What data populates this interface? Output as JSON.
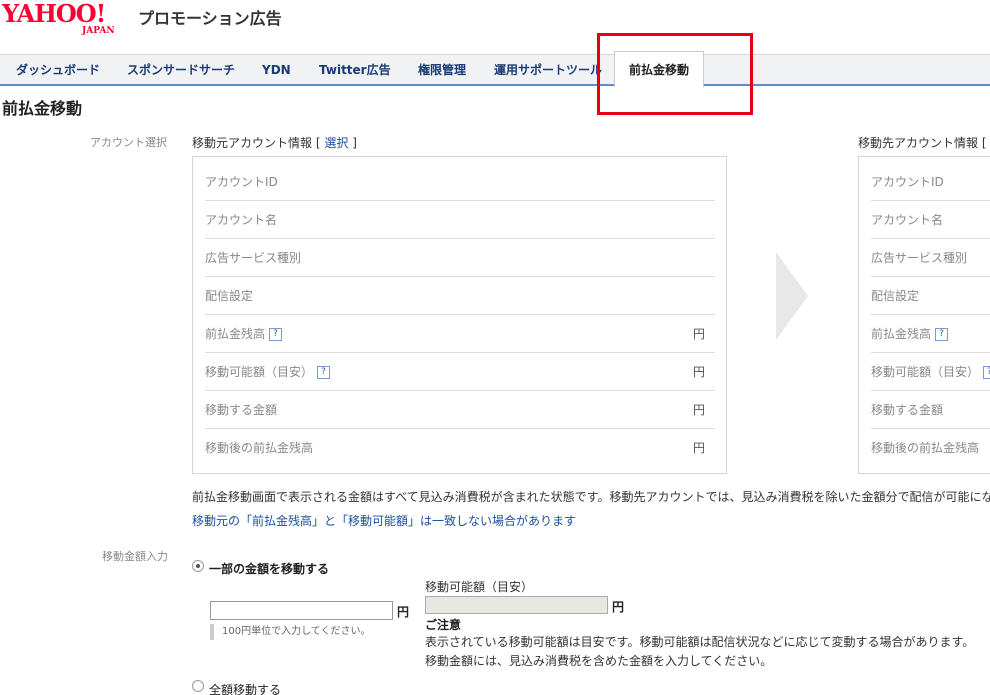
{
  "header": {
    "logo_text": "YAHOO!",
    "logo_sub": "JAPAN",
    "product_name": "プロモーション広告"
  },
  "nav": {
    "tabs": [
      {
        "label": "ダッシュボード"
      },
      {
        "label": "スポンサードサーチ"
      },
      {
        "label": "YDN"
      },
      {
        "label": "Twitter広告"
      },
      {
        "label": "権限管理"
      },
      {
        "label": "運用サポートツール"
      },
      {
        "label": "前払金移動",
        "active": true
      }
    ]
  },
  "page_title": "前払金移動",
  "account_select": {
    "label": "アカウント選択",
    "source": {
      "heading": "移動元アカウント情報",
      "bracket_open": "[",
      "select_link": "選択",
      "bracket_close": "]",
      "rows": [
        {
          "label": "アカウントID",
          "value": ""
        },
        {
          "label": "アカウント名",
          "value": ""
        },
        {
          "label": "広告サービス種別",
          "value": ""
        },
        {
          "label": "配信設定",
          "value": ""
        },
        {
          "label": "前払金残高",
          "help": "?",
          "unit": "円"
        },
        {
          "label": "移動可能額（目安）",
          "help": "?",
          "unit": "円"
        },
        {
          "label": "移動する金額",
          "unit": "円"
        },
        {
          "label": "移動後の前払金残高",
          "unit": "円"
        }
      ]
    },
    "destination": {
      "heading": "移動先アカウント情報 [",
      "rows": [
        {
          "label": "アカウントID"
        },
        {
          "label": "アカウント名"
        },
        {
          "label": "広告サービス種別"
        },
        {
          "label": "配信設定"
        },
        {
          "label": "前払金残高",
          "help": "?"
        },
        {
          "label": "移動可能額（目安）",
          "help": "?"
        },
        {
          "label": "移動する金額"
        },
        {
          "label": "移動後の前払金残高"
        }
      ]
    }
  },
  "notes": {
    "line1": "前払金移動画面で表示される金額はすべて見込み消費税が含まれた状態です。移動先アカウントでは、見込み消費税を除いた金額分で配信が可能にな",
    "line2": "移動元の「前払金残高」と「移動可能額」は一致しない場合があります"
  },
  "amount_input": {
    "label": "移動金額入力",
    "option_partial": "一部の金額を移動する",
    "input_value": "",
    "yen": "円",
    "hint": "100円単位で入力してください。",
    "available_label": "移動可能額（目安）",
    "available_yen": "円",
    "caution_title": "ご注意",
    "caution_line1": "表示されている移動可能額は目安です。移動可能額は配信状況などに応じて変動する場合があります。",
    "caution_line2": "移動金額には、見込み消費税を含めた金額を入力してください。",
    "option_all": "全額移動する"
  },
  "colors": {
    "brand_red": "#ff0033",
    "nav_accent": "#5b8ed0",
    "highlight": "#e60012",
    "link": "#1a4fa0"
  }
}
